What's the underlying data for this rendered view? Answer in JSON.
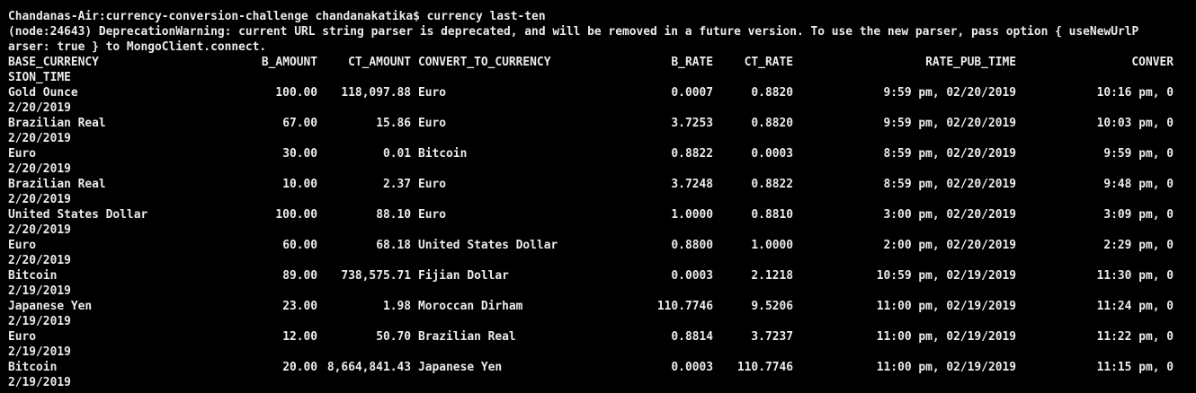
{
  "terminal": {
    "prompt_line": "Chandanas-Air:currency-conversion-challenge chandanakatika$ currency last-ten",
    "warning_line_1": "(node:24643) DeprecationWarning: current URL string parser is deprecated, and will be removed in a future version. To use the new parser, pass option { useNewUrlP",
    "warning_line_2": "arser: true } to MongoClient.connect."
  },
  "table": {
    "headers": {
      "base_currency": "BASE_CURRENCY",
      "b_amount": "B_AMOUNT",
      "ct_amount": "CT_AMOUNT",
      "convert_to_currency": "CONVERT_TO_CURRENCY",
      "b_rate": "B_RATE",
      "ct_rate": "CT_RATE",
      "rate_pub_time": "RATE_PUB_TIME",
      "conversion_time_part1": "CONVER",
      "conversion_time_part2": "SION_TIME"
    },
    "rows": [
      {
        "base": "Gold Ounce",
        "b_amount": "100.00",
        "ct_amount": "118,097.88",
        "convert_to": "Euro",
        "b_rate": "0.0007",
        "ct_rate": "0.8820",
        "rate_pub_time": "9:59 pm, 02/20/2019",
        "conv_time_a": "10:16 pm, 0",
        "conv_time_b": "2/20/2019"
      },
      {
        "base": "Brazilian Real",
        "b_amount": "67.00",
        "ct_amount": "15.86",
        "convert_to": "Euro",
        "b_rate": "3.7253",
        "ct_rate": "0.8820",
        "rate_pub_time": "9:59 pm, 02/20/2019",
        "conv_time_a": "10:03 pm, 0",
        "conv_time_b": "2/20/2019"
      },
      {
        "base": "Euro",
        "b_amount": "30.00",
        "ct_amount": "0.01",
        "convert_to": "Bitcoin",
        "b_rate": "0.8822",
        "ct_rate": "0.0003",
        "rate_pub_time": "8:59 pm, 02/20/2019",
        "conv_time_a": "9:59 pm, 0",
        "conv_time_b": "2/20/2019"
      },
      {
        "base": "Brazilian Real",
        "b_amount": "10.00",
        "ct_amount": "2.37",
        "convert_to": "Euro",
        "b_rate": "3.7248",
        "ct_rate": "0.8822",
        "rate_pub_time": "8:59 pm, 02/20/2019",
        "conv_time_a": "9:48 pm, 0",
        "conv_time_b": "2/20/2019"
      },
      {
        "base": "United States Dollar",
        "b_amount": "100.00",
        "ct_amount": "88.10",
        "convert_to": "Euro",
        "b_rate": "1.0000",
        "ct_rate": "0.8810",
        "rate_pub_time": "3:00 pm, 02/20/2019",
        "conv_time_a": "3:09 pm, 0",
        "conv_time_b": "2/20/2019"
      },
      {
        "base": "Euro",
        "b_amount": "60.00",
        "ct_amount": "68.18",
        "convert_to": "United States Dollar",
        "b_rate": "0.8800",
        "ct_rate": "1.0000",
        "rate_pub_time": "2:00 pm, 02/20/2019",
        "conv_time_a": "2:29 pm, 0",
        "conv_time_b": "2/20/2019"
      },
      {
        "base": "Bitcoin",
        "b_amount": "89.00",
        "ct_amount": "738,575.71",
        "convert_to": "Fijian Dollar",
        "b_rate": "0.0003",
        "ct_rate": "2.1218",
        "rate_pub_time": "10:59 pm, 02/19/2019",
        "conv_time_a": "11:30 pm, 0",
        "conv_time_b": "2/19/2019"
      },
      {
        "base": "Japanese Yen",
        "b_amount": "23.00",
        "ct_amount": "1.98",
        "convert_to": "Moroccan Dirham",
        "b_rate": "110.7746",
        "ct_rate": "9.5206",
        "rate_pub_time": "11:00 pm, 02/19/2019",
        "conv_time_a": "11:24 pm, 0",
        "conv_time_b": "2/19/2019"
      },
      {
        "base": "Euro",
        "b_amount": "12.00",
        "ct_amount": "50.70",
        "convert_to": "Brazilian Real",
        "b_rate": "0.8814",
        "ct_rate": "3.7237",
        "rate_pub_time": "11:00 pm, 02/19/2019",
        "conv_time_a": "11:22 pm, 0",
        "conv_time_b": "2/19/2019"
      },
      {
        "base": "Bitcoin",
        "b_amount": "20.00",
        "ct_amount": "8,664,841.43",
        "convert_to": "Japanese Yen",
        "b_rate": "0.0003",
        "ct_rate": "110.7746",
        "rate_pub_time": "11:00 pm, 02/19/2019",
        "conv_time_a": "11:15 pm, 0",
        "conv_time_b": "2/19/2019"
      }
    ]
  },
  "colors": {
    "background": "#000000",
    "text": "#ececec"
  }
}
